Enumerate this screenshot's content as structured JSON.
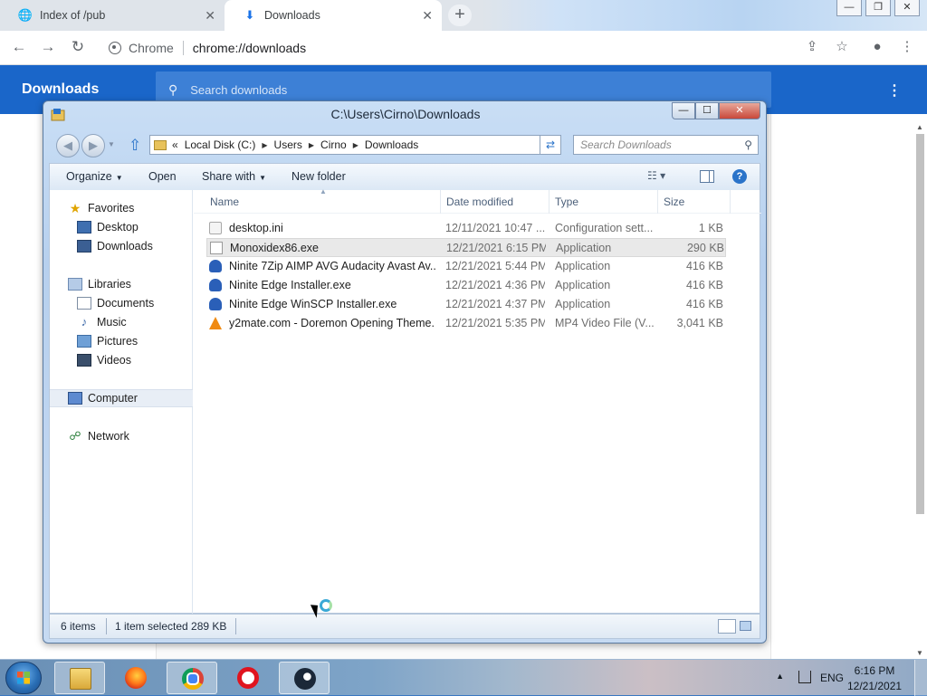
{
  "browser": {
    "tabs": [
      {
        "label": "Index of /pub",
        "icon": "globe-icon",
        "active": false
      },
      {
        "label": "Downloads",
        "icon": "download-icon",
        "active": true
      }
    ],
    "window_controls": [
      "minimize",
      "restore",
      "close"
    ],
    "omnibox": {
      "site_label": "Chrome",
      "url": "chrome://downloads"
    },
    "downloads_page": {
      "title": "Downloads",
      "search_placeholder": "Search downloads",
      "menu_icon": "more-vert-icon",
      "header_color": "#1a66c9"
    }
  },
  "explorer": {
    "title": "C:\\Users\\Cirno\\Downloads",
    "breadcrumb": [
      "Local Disk (C:)",
      "Users",
      "Cirno",
      "Downloads"
    ],
    "breadcrumb_overflow": "«",
    "search_placeholder": "Search Downloads",
    "commands": {
      "organize": "Organize",
      "open": "Open",
      "share_with": "Share with",
      "new_folder": "New folder"
    },
    "nav_pane": {
      "favorites": {
        "label": "Favorites",
        "items": [
          "Desktop",
          "Downloads"
        ]
      },
      "libraries": {
        "label": "Libraries",
        "items": [
          "Documents",
          "Music",
          "Pictures",
          "Videos"
        ]
      },
      "computer": "Computer",
      "network": "Network"
    },
    "columns": {
      "name": "Name",
      "date": "Date modified",
      "type": "Type",
      "size": "Size"
    },
    "files": [
      {
        "name": "desktop.ini",
        "date": "12/11/2021 10:47 ...",
        "type": "Configuration sett...",
        "size": "1 KB",
        "icon": "ini-file-icon",
        "selected": false
      },
      {
        "name": "Monoxidex86.exe",
        "date": "12/21/2021 6:15 PM",
        "type": "Application",
        "size": "290 KB",
        "icon": "blank-exe-icon",
        "selected": true
      },
      {
        "name": "Ninite 7Zip AIMP AVG Audacity Avast Av...",
        "date": "12/21/2021 5:44 PM",
        "type": "Application",
        "size": "416 KB",
        "icon": "ninite-icon",
        "selected": false
      },
      {
        "name": "Ninite Edge Installer.exe",
        "date": "12/21/2021 4:36 PM",
        "type": "Application",
        "size": "416 KB",
        "icon": "ninite-icon",
        "selected": false
      },
      {
        "name": "Ninite Edge WinSCP Installer.exe",
        "date": "12/21/2021 4:37 PM",
        "type": "Application",
        "size": "416 KB",
        "icon": "ninite-icon",
        "selected": false
      },
      {
        "name": "y2mate.com - Doremon Opening Theme...",
        "date": "12/21/2021 5:35 PM",
        "type": "MP4 Video File (V...",
        "size": "3,041 KB",
        "icon": "vlc-icon",
        "selected": false
      }
    ],
    "status": {
      "item_count": "6 items",
      "selection": "1 item selected  289 KB"
    }
  },
  "taskbar": {
    "pinned": [
      "explorer-icon",
      "firefox-icon",
      "chrome-icon",
      "opera-icon",
      "steam-icon"
    ],
    "language": "ENG",
    "time": "6:16 PM",
    "date": "12/21/2021"
  }
}
